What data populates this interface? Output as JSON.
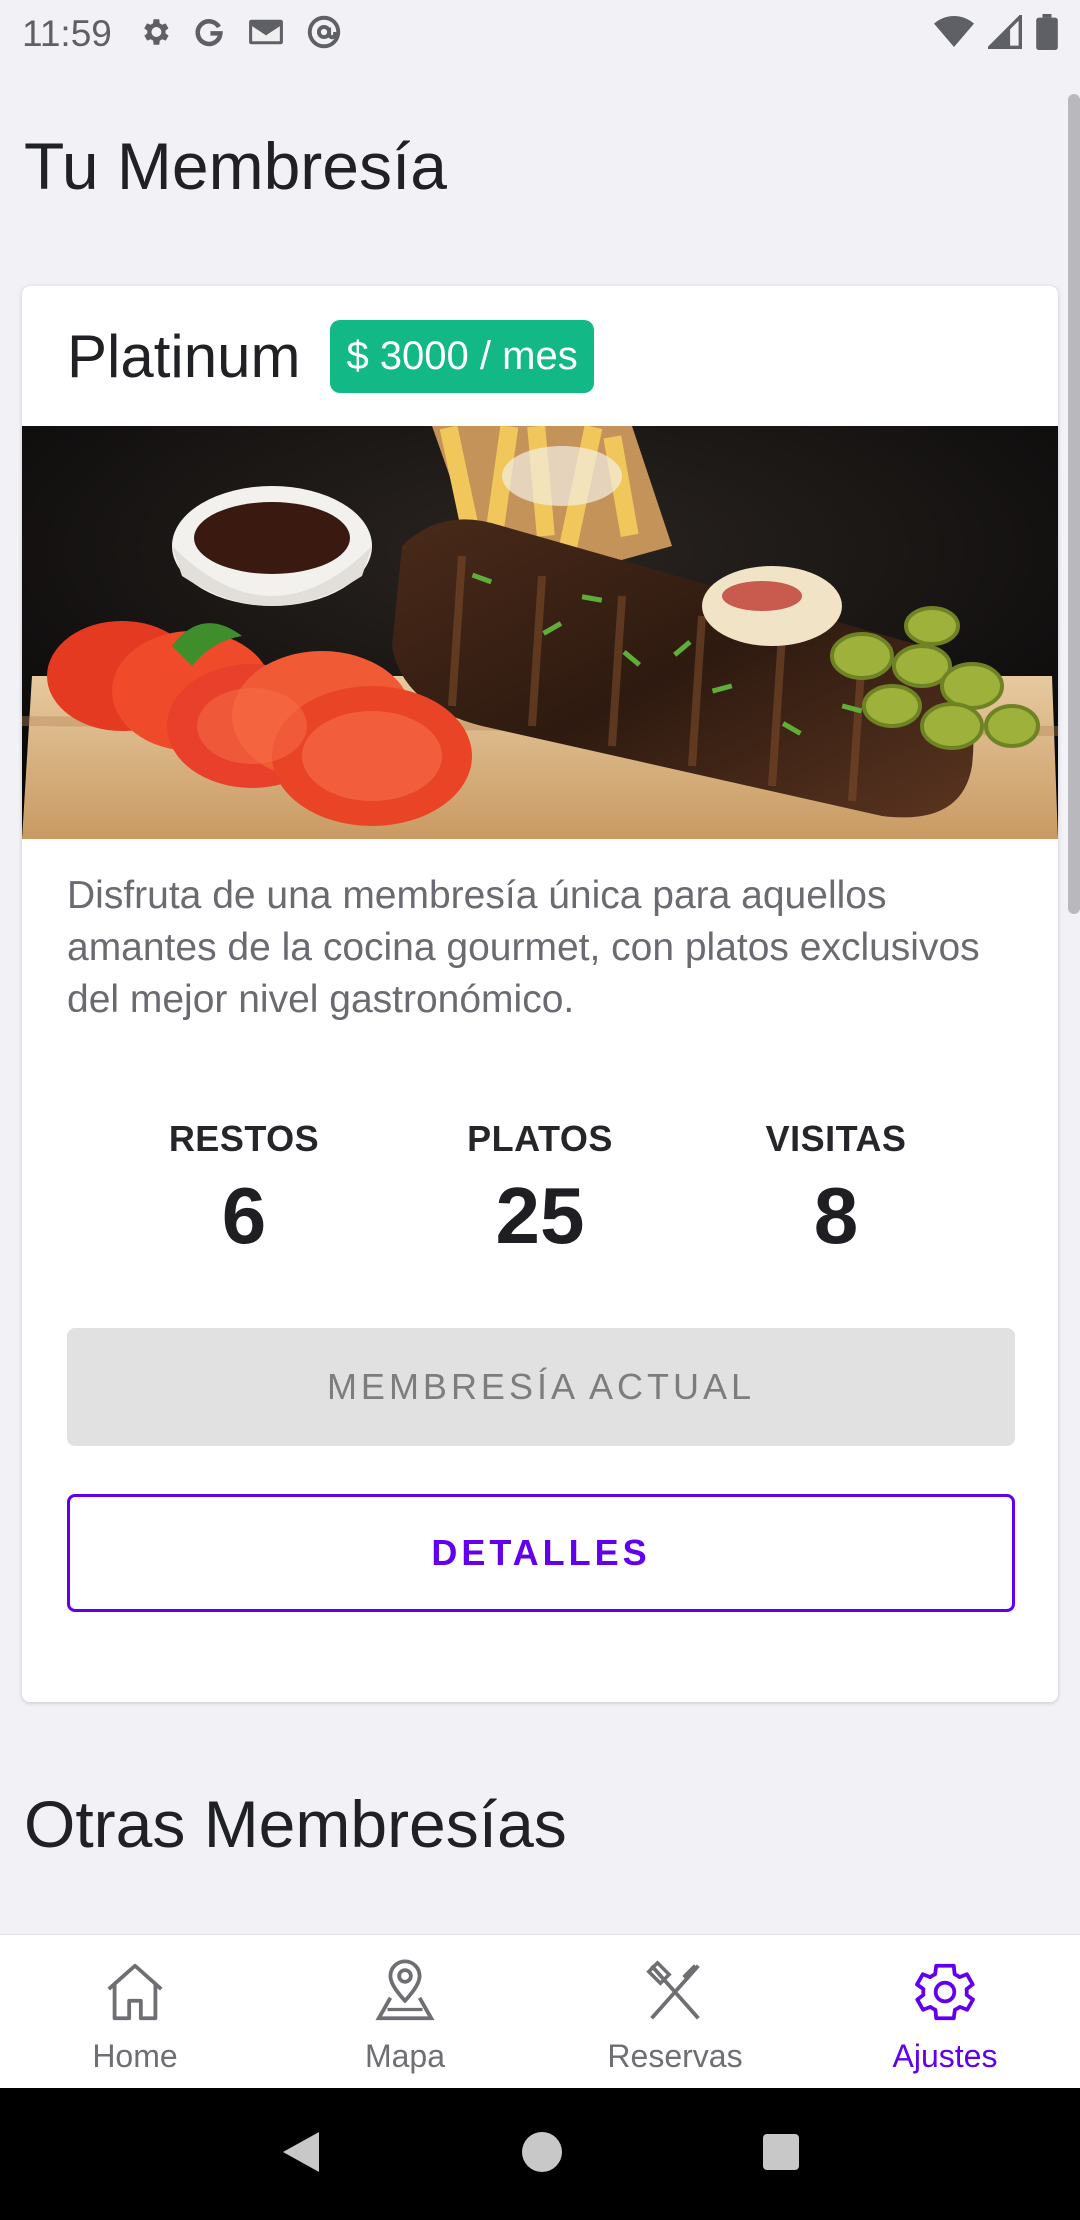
{
  "status_bar": {
    "time": "11:59",
    "left_icons": [
      "gear-icon",
      "google-icon",
      "gmail-icon",
      "at-sign-icon"
    ],
    "right_icons": [
      "wifi-icon",
      "signal-icon",
      "battery-icon"
    ]
  },
  "page": {
    "title": "Tu Membresía",
    "section_title": "Otras Membresías"
  },
  "membership": {
    "name": "Platinum",
    "price": "$ 3000 / mes",
    "image": "ribs-platter-photo",
    "description": "Disfruta de una membresía única para aquellos amantes de la cocina gourmet, con platos exclusivos del mejor nivel gastronómico.",
    "stats": [
      {
        "label": "RESTOS",
        "value": "6"
      },
      {
        "label": "PLATOS",
        "value": "25"
      },
      {
        "label": "VISITAS",
        "value": "8"
      }
    ],
    "current_button": "MEMBRESÍA ACTUAL",
    "details_button": "DETALLES"
  },
  "bottom_nav": {
    "items": [
      {
        "label": "Home",
        "icon": "home-icon"
      },
      {
        "label": "Mapa",
        "icon": "map-pin-icon"
      },
      {
        "label": "Reservas",
        "icon": "fork-knife-icon"
      },
      {
        "label": "Ajustes",
        "icon": "gear-icon"
      }
    ],
    "active": "Ajustes"
  },
  "colors": {
    "accent": "#6200ee",
    "badge": "#12b886",
    "background": "#f2f1f6"
  }
}
